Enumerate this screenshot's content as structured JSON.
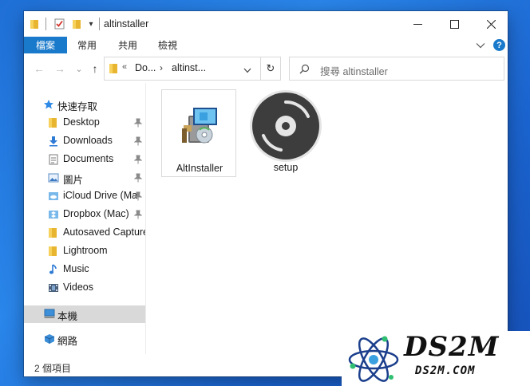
{
  "window": {
    "title": "altinstaller",
    "controls": {
      "minimize": "—",
      "maximize": "☐",
      "close": "✕"
    },
    "quick_access_dropdown": "▾"
  },
  "ribbon": {
    "tabs": [
      "檔案",
      "常用",
      "共用",
      "檢視"
    ],
    "expand_chevron": "⌄",
    "help": "?"
  },
  "address_bar": {
    "breadcrumbs": [
      "Do...",
      "altinst..."
    ],
    "overflow": "«",
    "dropdown": "⌄",
    "refresh": "↻",
    "search_placeholder": "搜尋 altinstaller"
  },
  "nav": {
    "back": "←",
    "forward": "→",
    "recent": "⌄",
    "up": "↑"
  },
  "sidebar": {
    "quick_access": {
      "label": "快速存取",
      "icon": "star-icon"
    },
    "items": [
      {
        "label": "Desktop",
        "icon": "folder-icon",
        "pinned": true
      },
      {
        "label": "Downloads",
        "icon": "download-icon",
        "pinned": true
      },
      {
        "label": "Documents",
        "icon": "documents-icon",
        "pinned": true
      },
      {
        "label": "圖片",
        "icon": "pictures-icon",
        "pinned": true
      },
      {
        "label": "iCloud Drive (Ma",
        "icon": "cloud-folder-icon",
        "pinned": true
      },
      {
        "label": "Dropbox (Mac)",
        "icon": "cloud-folder-icon",
        "pinned": true
      },
      {
        "label": "Autosaved Capture",
        "icon": "folder-icon",
        "pinned": false
      },
      {
        "label": "Lightroom",
        "icon": "folder-icon",
        "pinned": false
      },
      {
        "label": "Music",
        "icon": "music-icon",
        "pinned": false
      },
      {
        "label": "Videos",
        "icon": "videos-icon",
        "pinned": false
      }
    ],
    "this_pc": {
      "label": "本機",
      "icon": "computer-icon"
    },
    "network": {
      "label": "網路",
      "icon": "network-icon"
    }
  },
  "content": {
    "files": [
      {
        "name": "AltInstaller",
        "icon": "installer-icon",
        "selected": true
      },
      {
        "name": "setup",
        "icon": "disc-icon",
        "selected": false
      }
    ]
  },
  "status": {
    "item_count": "2 個項目"
  },
  "watermark": {
    "brand": "DS2M",
    "url": "DS2M.COM"
  },
  "colors": {
    "accent": "#1979ca",
    "selection": "#cce8ff",
    "hover": "#d9d9d9",
    "folder": "#f3c441",
    "desktop_bg": "#1f6fd6"
  }
}
